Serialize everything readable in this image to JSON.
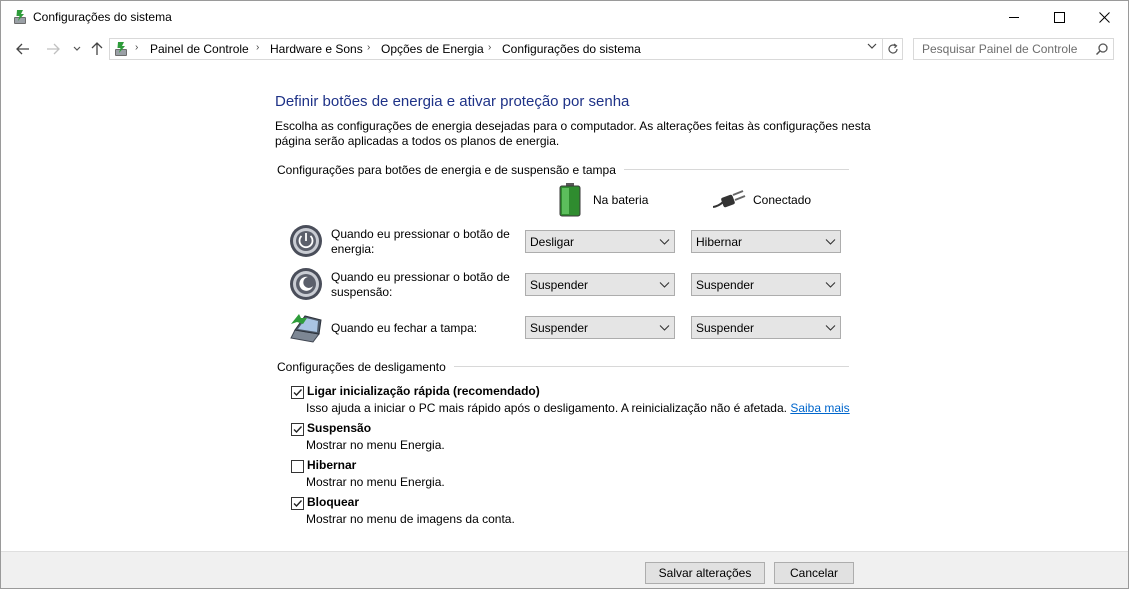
{
  "window": {
    "title": "Configurações do sistema",
    "controls": {
      "minimize": "—",
      "maximize": "☐",
      "close": "✕"
    }
  },
  "navigation": {
    "back": "←",
    "forward": "→",
    "recent": "⌄",
    "up": "↑",
    "breadcrumb": [
      "Painel de Controle",
      "Hardware e Sons",
      "Opções de Energia",
      "Configurações do sistema"
    ],
    "separator": "›",
    "dropdown": "⌄",
    "refresh": "↻",
    "search_placeholder": "Pesquisar Painel de Controle"
  },
  "page": {
    "heading": "Definir botões de energia e ativar proteção por senha",
    "intro": "Escolha as configurações de energia desejadas para o computador. As alterações feitas às configurações nesta página serão aplicadas a todos os planos de energia."
  },
  "power_buttons": {
    "group_title": "Configurações para botões de energia e de suspensão e tampa",
    "col_battery": "Na bateria",
    "col_plugged": "Conectado",
    "rows": [
      {
        "label": "Quando eu pressionar o botão de energia:",
        "battery": "Desligar",
        "plugged": "Hibernar",
        "icon": "power-button-icon"
      },
      {
        "label": "Quando eu pressionar o botão de suspensão:",
        "battery": "Suspender",
        "plugged": "Suspender",
        "icon": "sleep-button-icon"
      },
      {
        "label": "Quando eu fechar a tampa:",
        "battery": "Suspender",
        "plugged": "Suspender",
        "icon": "laptop-lid-icon"
      }
    ]
  },
  "shutdown": {
    "group_title": "Configurações de desligamento",
    "items": [
      {
        "label": "Ligar inicialização rápida (recomendado)",
        "desc": "Isso ajuda a iniciar o PC mais rápido após o desligamento. A reinicialização não é afetada.",
        "link": "Saiba mais",
        "checked": true
      },
      {
        "label": "Suspensão",
        "desc": "Mostrar no menu Energia.",
        "checked": true
      },
      {
        "label": "Hibernar",
        "desc": "Mostrar no menu Energia.",
        "checked": false
      },
      {
        "label": "Bloquear",
        "desc": "Mostrar no menu de imagens da conta.",
        "checked": true
      }
    ]
  },
  "footer": {
    "save": "Salvar alterações",
    "cancel": "Cancelar"
  },
  "colors": {
    "heading": "#1e3287",
    "link": "#0066cc",
    "battery_green": "#3cb043"
  }
}
